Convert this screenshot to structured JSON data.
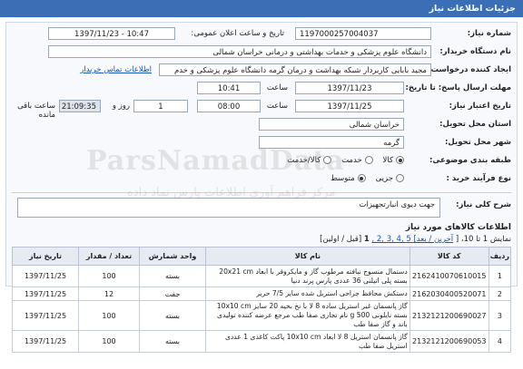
{
  "header": {
    "title": "جزئیات اطلاعات نیاز"
  },
  "form": {
    "need_number_label": "شماره نیاز:",
    "need_number": "1197000257004037",
    "announce_label": "تاریخ و ساعت اعلان عمومی:",
    "announce_value": "1397/11/23 - 10:47",
    "buyer_label": "نام دستگاه خریدار:",
    "buyer_value": "دانشگاه علوم پزشکی و خدمات بهداشتی و درمانی خراسان شمالی",
    "creator_label": "ایجاد کننده درخواست:",
    "creator_value": "مجید بابایی کاربردار شبکه بهداشت و درمان گرمه دانشگاه علوم پزشکی و خدم",
    "contact_link": "اطلاعات تماس خریدار",
    "reply_deadline_label": "مهلت ارسال پاسخ: تا تاریخ:",
    "reply_date": "1397/11/23",
    "time_label": "ساعت",
    "reply_time": "10:41",
    "validity_label": "تاریخ اعتبار نیاز:",
    "validity_date": "1397/11/25",
    "validity_time": "08:00",
    "days_value": "1",
    "days_label": "روز و",
    "remaining_time": "21:09:35",
    "remaining_label": "ساعت باقی مانده",
    "province_label": "استان محل تحویل:",
    "province_value": "خراسان شمالی",
    "city_label": "شهر محل تحویل:",
    "city_value": "گرمه",
    "category_label": "طبقه بندی موضوعی:",
    "category_options": [
      "کالا",
      "خدمت",
      "کالا/خدمت"
    ],
    "category_selected": "کالا",
    "process_label": "نوع فرآیند خرید :",
    "process_options": [
      "جزیی",
      "متوسط"
    ],
    "process_selected": "متوسط"
  },
  "description": {
    "label": "شرح کلی نیاز:",
    "value": "جهت دیوی انبارتجهیزات"
  },
  "goods": {
    "title": "اطلاعات کالاهای مورد نیاز",
    "pager_prefix": "نمایش 1 تا 10، [",
    "pager_links": "آخرین / بعد] 5 ,4 ,3 ,2 ,",
    "pager_current": "1",
    "pager_suffix": "[قبل / اولین]",
    "columns": [
      "ردیف",
      "کد کالا",
      "نام کالا",
      "واحد شمارش",
      "تعداد / مقدار",
      "تاریخ نیاز"
    ],
    "rows": [
      {
        "idx": "1",
        "code": "2162410070610015",
        "name": "دستمال منسوج نبافته مرطوب گاز و مایکروفر با ابعاد 20x21 cm بسته پلی اتیلنی 36 عددی پارس پرند دنیا",
        "unit": "بسته",
        "qty": "100",
        "date": "1397/11/25"
      },
      {
        "idx": "2",
        "code": "2162030400520071",
        "name": "دستکش محافظ جراحی استریل شده سایز 7/5 حریر",
        "unit": "جفت",
        "qty": "12",
        "date": "1397/11/25"
      },
      {
        "idx": "3",
        "code": "2132121200690027",
        "name": "گاز پانسمان غیر استریل ساده 8 لا با نخ بخیه 20 سایز 10x10 cm بسته نایلونی 500 g نام تجاری صفا طب مرجع عرضه کننده تولیدی باند و گاز صفا طب",
        "unit": "بسته",
        "qty": "100",
        "date": "1397/11/25"
      },
      {
        "idx": "4",
        "code": "2132121200690053",
        "name": "گاز پانسمان استریل 8 لا ابعاد 10x10 cm پاکت کاغذی 1 عددی استریل صفا طب",
        "unit": "بسته",
        "qty": "100",
        "date": "1397/11/25"
      }
    ]
  },
  "watermark": {
    "line1": "ParsNamadData",
    "line2": "مرکز فراهم آوری اطلاعات پارس نماد داده"
  }
}
